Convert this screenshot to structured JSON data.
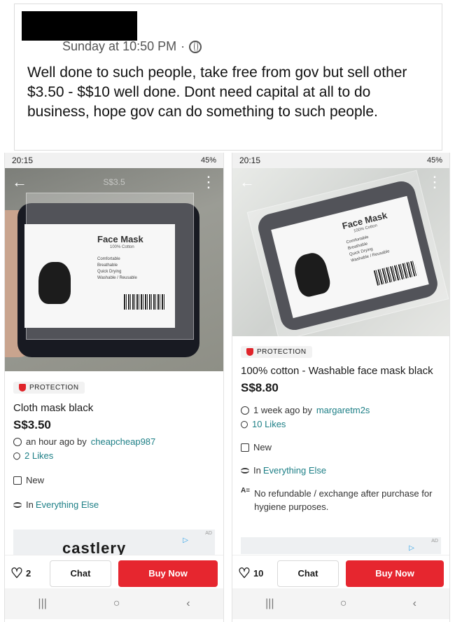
{
  "post": {
    "timestamp": "Sunday at 10:50 PM",
    "separator": "·",
    "text": "Well done to such people, take free from gov but sell other $3.50 - $$10 well done. Dont need capital at all to do business, hope  gov can do something to such people."
  },
  "status_bar": {
    "time": "20:15",
    "indicators": "45%"
  },
  "listings": [
    {
      "photo_label": {
        "title": "Face Mask",
        "sub": "100% Cotton",
        "features": [
          "Comfortable",
          "Breathable",
          "Quick Drying",
          "Washable / Reusable"
        ]
      },
      "watermark": "S$3.5",
      "protection": "PROTECTION",
      "title": "Cloth mask black",
      "price": "S$3.50",
      "posted": "an hour ago by",
      "seller": "cheapcheap987",
      "likes": "2 Likes",
      "condition": "New",
      "category_prefix": "In",
      "category": "Everything Else",
      "ad_text": "castlery",
      "ad_tag": "AD",
      "like_count": "2",
      "chat_label": "Chat",
      "buy_label": "Buy Now"
    },
    {
      "photo_label": {
        "title": "Face Mask",
        "sub": "100% Cotton",
        "features": [
          "Comfortable",
          "Breathable",
          "Quick Drying",
          "Washable / Reusable"
        ]
      },
      "protection": "PROTECTION",
      "title": "100% cotton - Washable face mask black",
      "price": "S$8.80",
      "posted": "1 week ago by",
      "seller": "margaretm2s",
      "likes": "10 Likes",
      "condition": "New",
      "category_prefix": "In",
      "category": "Everything Else",
      "note": "No refundable / exchange after purchase for hygiene purposes.",
      "ad_tag": "AD",
      "like_count": "10",
      "chat_label": "Chat",
      "buy_label": "Buy Now"
    }
  ],
  "icons": [
    "back-arrow-icon",
    "more-vert-icon",
    "shield-icon",
    "clock-icon",
    "heart-icon",
    "tag-icon",
    "list-icon",
    "text-icon",
    "globe-icon"
  ],
  "colors": {
    "buy": "#e6262f",
    "link": "#1d7f86",
    "protection": "#e0242a"
  }
}
